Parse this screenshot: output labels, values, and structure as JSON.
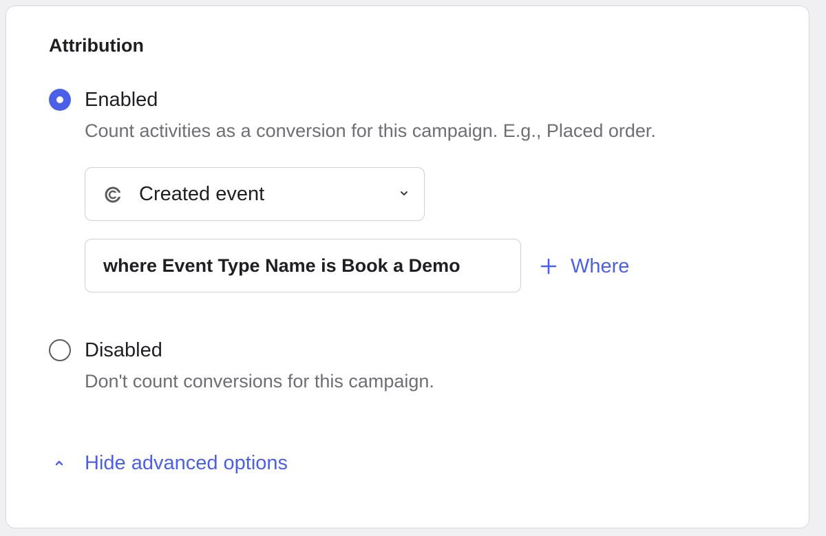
{
  "section": {
    "title": "Attribution"
  },
  "options": {
    "enabled": {
      "label": "Enabled",
      "description": "Count activities as a conversion for this campaign. E.g., Placed order.",
      "selected": true
    },
    "disabled": {
      "label": "Disabled",
      "description": "Don't count conversions for this campaign.",
      "selected": false
    }
  },
  "event_select": {
    "value": "Created event",
    "icon": "calendly-icon"
  },
  "filter": {
    "text": "where Event Type Name is Book a Demo"
  },
  "where_button": {
    "label": "Where",
    "icon": "plus-icon"
  },
  "advanced": {
    "label": "Hide advanced options",
    "icon": "chevron-up-icon"
  },
  "colors": {
    "accent": "#4a60e6",
    "text": "#1f1f23",
    "muted": "#6e6e75",
    "border": "#cfcfd4"
  }
}
